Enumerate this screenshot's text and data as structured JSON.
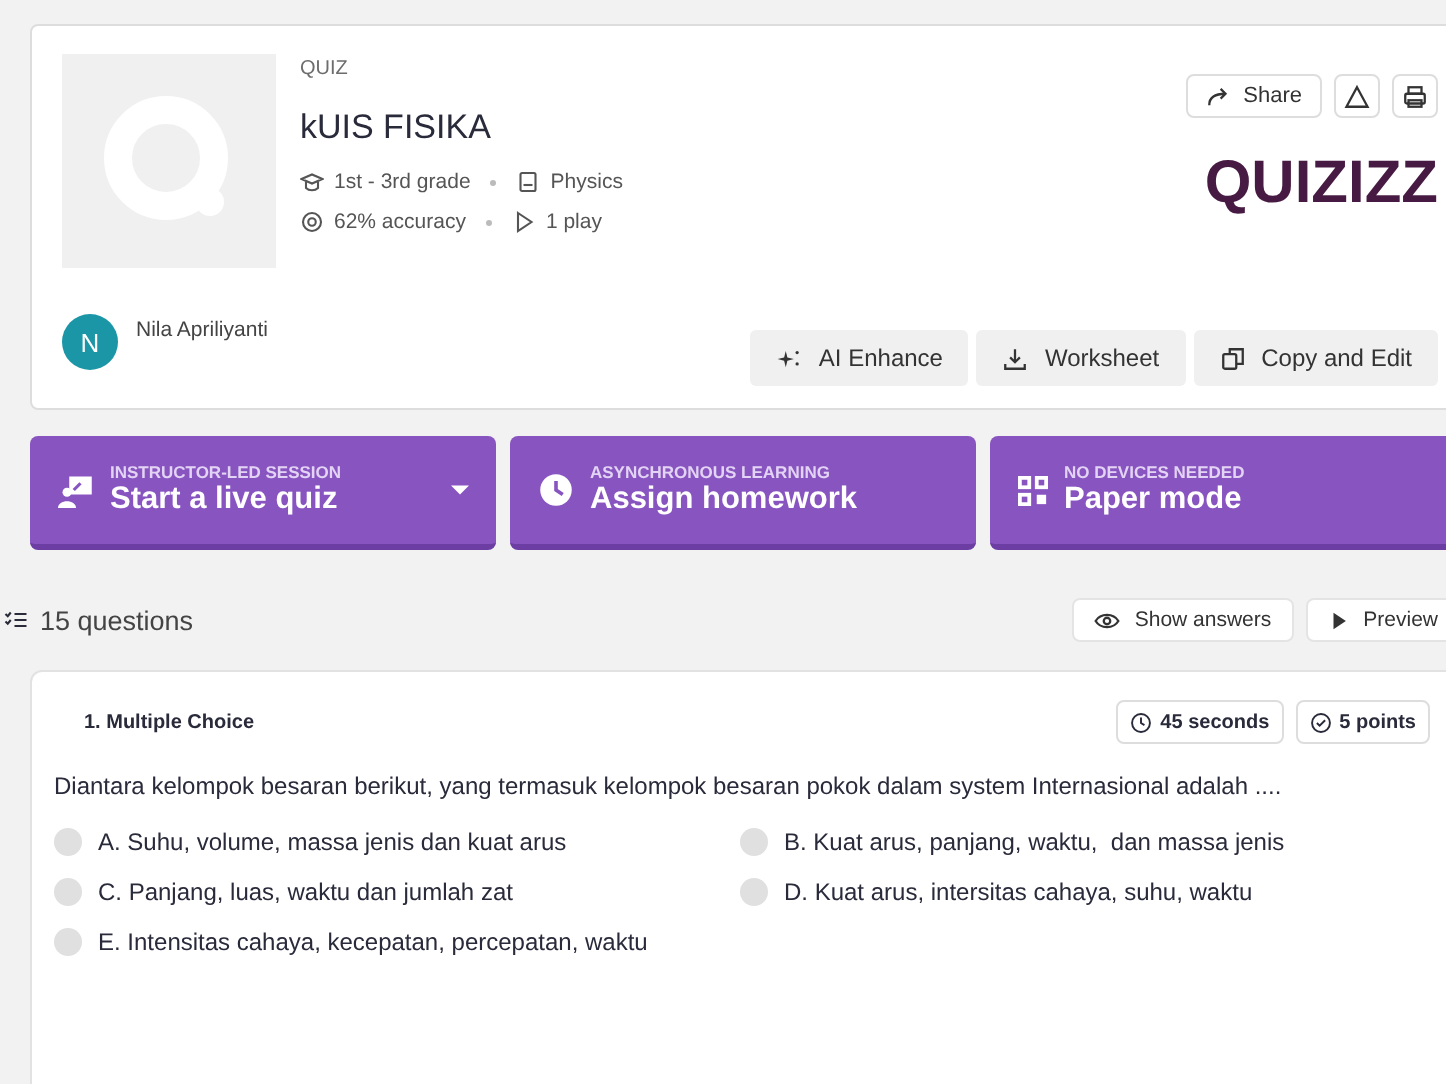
{
  "quiz": {
    "type_label": "QUIZ",
    "title": "kUIS FISIKA",
    "grade": "1st - 3rd grade",
    "subject": "Physics",
    "accuracy": "62% accuracy",
    "plays": "1 play",
    "author": {
      "initial": "N",
      "name": "Nila Apriliyanti"
    },
    "logo": "QUIZIZZ"
  },
  "top_actions": [
    {
      "kind": "share",
      "label": "Share"
    },
    {
      "kind": "report"
    },
    {
      "kind": "print"
    }
  ],
  "tools": [
    {
      "kind": "ai",
      "label": "AI Enhance"
    },
    {
      "kind": "worksheet",
      "label": "Worksheet"
    },
    {
      "kind": "copy",
      "label": "Copy and Edit"
    }
  ],
  "modes": [
    {
      "kind": "live",
      "caption": "INSTRUCTOR-LED SESSION",
      "label": "Start a live quiz",
      "dropdown": true
    },
    {
      "kind": "homework",
      "caption": "ASYNCHRONOUS LEARNING",
      "label": "Assign homework",
      "dropdown": false
    },
    {
      "kind": "paper",
      "caption": "NO DEVICES NEEDED",
      "label": "Paper mode",
      "dropdown": false
    }
  ],
  "question_count": "15 questions",
  "view_buttons": [
    {
      "kind": "answers",
      "label": "Show answers"
    },
    {
      "kind": "preview",
      "label": "Preview"
    }
  ],
  "question": {
    "heading": "1. Multiple Choice",
    "time": "45 seconds",
    "points": "5 points",
    "text": "Diantara kelompok besaran berikut, yang termasuk kelompok besaran pokok dalam system Internasional adalah ....",
    "options": [
      {
        "label": "A. Suhu, volume, massa jenis dan kuat arus",
        "selected": false
      },
      {
        "label": "B. Kuat arus, panjang, waktu,  dan massa jenis",
        "selected": false
      },
      {
        "label": "C. Panjang, luas, waktu dan jumlah zat",
        "selected": false
      },
      {
        "label": "D. Kuat arus, intersitas cahaya, suhu, waktu",
        "selected": false
      },
      {
        "label": "E. Intensitas cahaya, kecepatan, percepatan, waktu",
        "selected": false
      }
    ]
  }
}
